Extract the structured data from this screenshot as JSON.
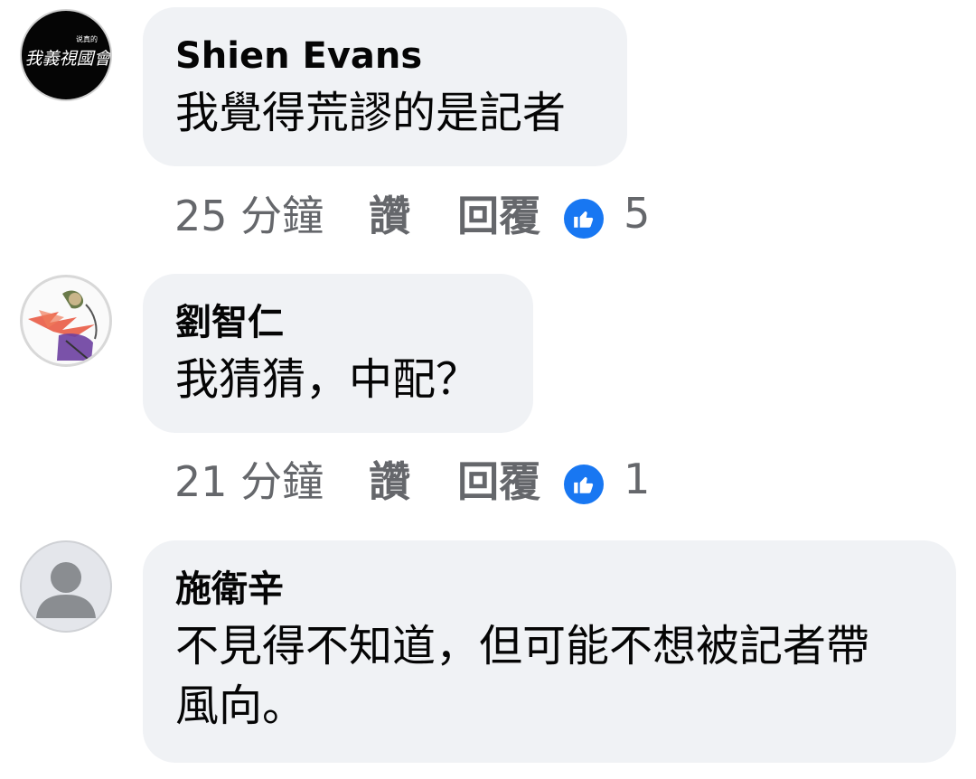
{
  "comments": [
    {
      "author": "Shien Evans",
      "text": "我覺得荒謬的是記者",
      "time": "25 分鐘",
      "like_label": "讚",
      "reply_label": "回覆",
      "reaction_count": "5",
      "avatar_text": "我義視國會"
    },
    {
      "author": "劉智仁",
      "text": "我猜猜，中配？",
      "time": "21 分鐘",
      "like_label": "讚",
      "reply_label": "回覆",
      "reaction_count": "1"
    },
    {
      "author": "施衛辛",
      "text_line1": "不見得不知道，但可能不想被記者帶",
      "text_line2": "風向。"
    }
  ],
  "colors": {
    "bubble": "#f0f2f5",
    "meta_text": "#65676b",
    "like_blue": "#1877f2",
    "text": "#050505"
  },
  "icons": {
    "reaction": "thumbs-up-icon",
    "default_avatar": "person-silhouette-icon"
  }
}
